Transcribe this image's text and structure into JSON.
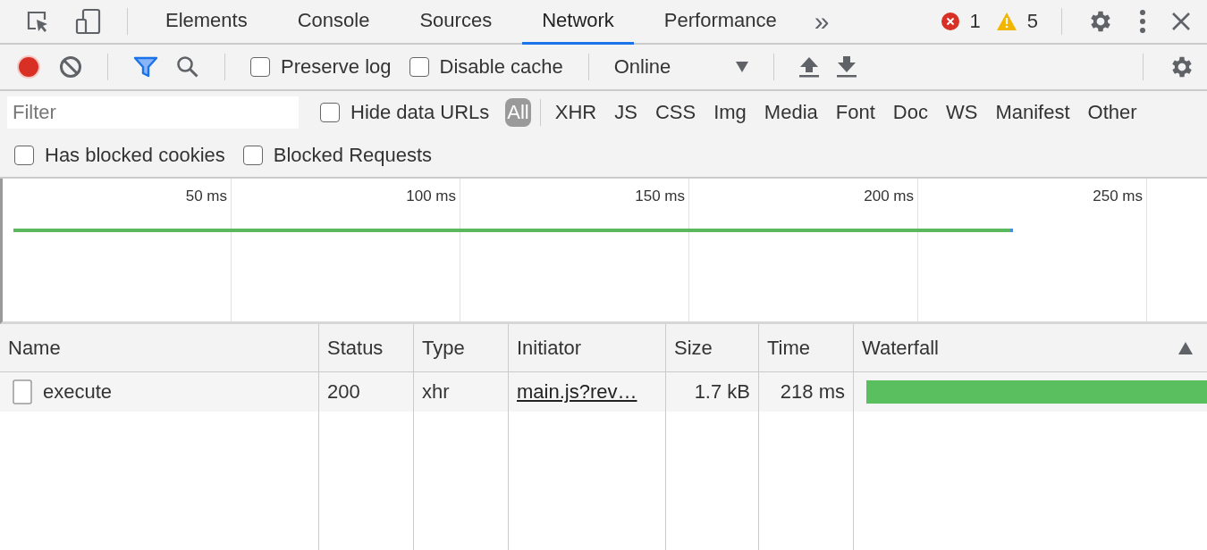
{
  "tabs": [
    {
      "label": "Elements",
      "selected": false
    },
    {
      "label": "Console",
      "selected": false
    },
    {
      "label": "Sources",
      "selected": false
    },
    {
      "label": "Network",
      "selected": true
    },
    {
      "label": "Performance",
      "selected": false
    }
  ],
  "more_tabs": "»",
  "errors": "1",
  "warnings": "5",
  "toolbar": {
    "recording": true,
    "filter_active": true,
    "preserve_log": {
      "label": "Preserve log",
      "checked": false
    },
    "disable_cache": {
      "label": "Disable cache",
      "checked": false
    },
    "throttling": "Online"
  },
  "filter": {
    "placeholder": "Filter",
    "hide_data_urls": {
      "label": "Hide data URLs",
      "checked": false
    },
    "types": [
      {
        "label": "All",
        "selected": true
      },
      {
        "label": "XHR",
        "selected": false
      },
      {
        "label": "JS",
        "selected": false
      },
      {
        "label": "CSS",
        "selected": false
      },
      {
        "label": "Img",
        "selected": false
      },
      {
        "label": "Media",
        "selected": false
      },
      {
        "label": "Font",
        "selected": false
      },
      {
        "label": "Doc",
        "selected": false
      },
      {
        "label": "WS",
        "selected": false
      },
      {
        "label": "Manifest",
        "selected": false
      },
      {
        "label": "Other",
        "selected": false
      }
    ],
    "has_blocked_cookies": {
      "label": "Has blocked cookies",
      "checked": false
    },
    "blocked_requests": {
      "label": "Blocked Requests",
      "checked": false
    }
  },
  "overview": {
    "ticks": [
      "50 ms",
      "100 ms",
      "150 ms",
      "200 ms",
      "250 ms"
    ]
  },
  "table": {
    "columns": [
      "Name",
      "Status",
      "Type",
      "Initiator",
      "Size",
      "Time",
      "Waterfall"
    ],
    "rows": [
      {
        "name": "execute",
        "status": "200",
        "type": "xhr",
        "initiator": "main.js?rev…",
        "size": "1.7 kB",
        "time": "218 ms"
      }
    ]
  }
}
